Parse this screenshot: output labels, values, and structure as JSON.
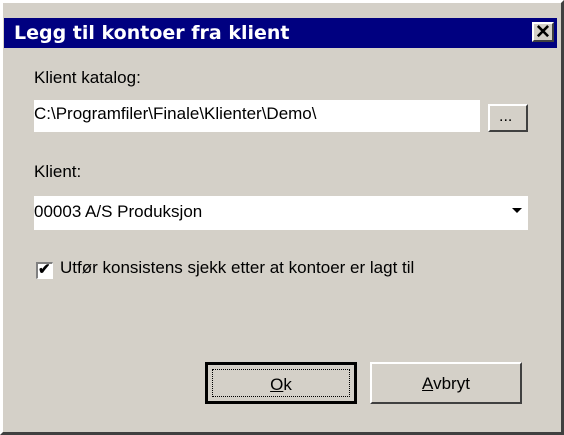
{
  "dialog": {
    "title": "Legg til kontoer fra klient",
    "close_glyph": "✕"
  },
  "catalog": {
    "label": "Klient katalog:",
    "value": "C:\\Programfiler\\Finale\\Klienter\\Demo\\",
    "browse_label": "..."
  },
  "client": {
    "label": "Klient:",
    "selected": "00003  A/S Produksjon"
  },
  "consistency": {
    "label": "Utfør konsistens sjekk etter at kontoer er lagt til",
    "checked": true,
    "check_glyph": "✔"
  },
  "buttons": {
    "ok_accel": "O",
    "ok_rest": "k",
    "cancel_accel": "A",
    "cancel_rest": "vbryt"
  }
}
